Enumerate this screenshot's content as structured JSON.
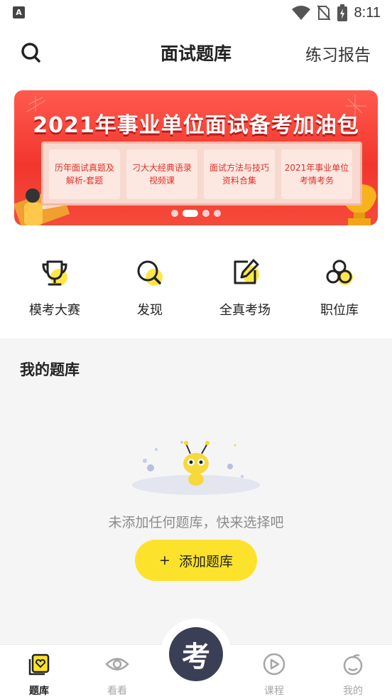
{
  "status_bar": {
    "time": "8:11",
    "app_icon_letter": "A"
  },
  "header": {
    "title": "面试题库",
    "report_label": "练习报告"
  },
  "banner": {
    "title": "2021年事业单位面试备考加油包",
    "cards": [
      "历年面试真题及解析-套题",
      "刁大大经典语录视频课",
      "面试方法与技巧资料合集",
      "2021年事业单位考情考务"
    ],
    "page_count": 4,
    "active_page": 1
  },
  "quick_entries": [
    {
      "label": "模考大赛",
      "icon": "trophy-icon"
    },
    {
      "label": "发现",
      "icon": "discover-search-icon"
    },
    {
      "label": "全真考场",
      "icon": "edit-icon"
    },
    {
      "label": "职位库",
      "icon": "circles-icon"
    }
  ],
  "my_bank": {
    "title": "我的题库",
    "empty_text": "未添加任何题库，快来选择吧",
    "add_button": {
      "plus": "+",
      "label": "添加题库"
    }
  },
  "tab_bar": {
    "tabs": [
      {
        "label": "题库",
        "icon": "question-bank-icon",
        "active": true
      },
      {
        "label": "看看",
        "icon": "eye-icon",
        "active": false
      },
      {
        "label": "课程",
        "icon": "play-icon",
        "active": false
      },
      {
        "label": "我的",
        "icon": "profile-icon",
        "active": false
      }
    ],
    "center_label": "考"
  },
  "colors": {
    "accent": "#fde22c",
    "banner_red": "#f2362e",
    "fab": "#3a3f55"
  }
}
